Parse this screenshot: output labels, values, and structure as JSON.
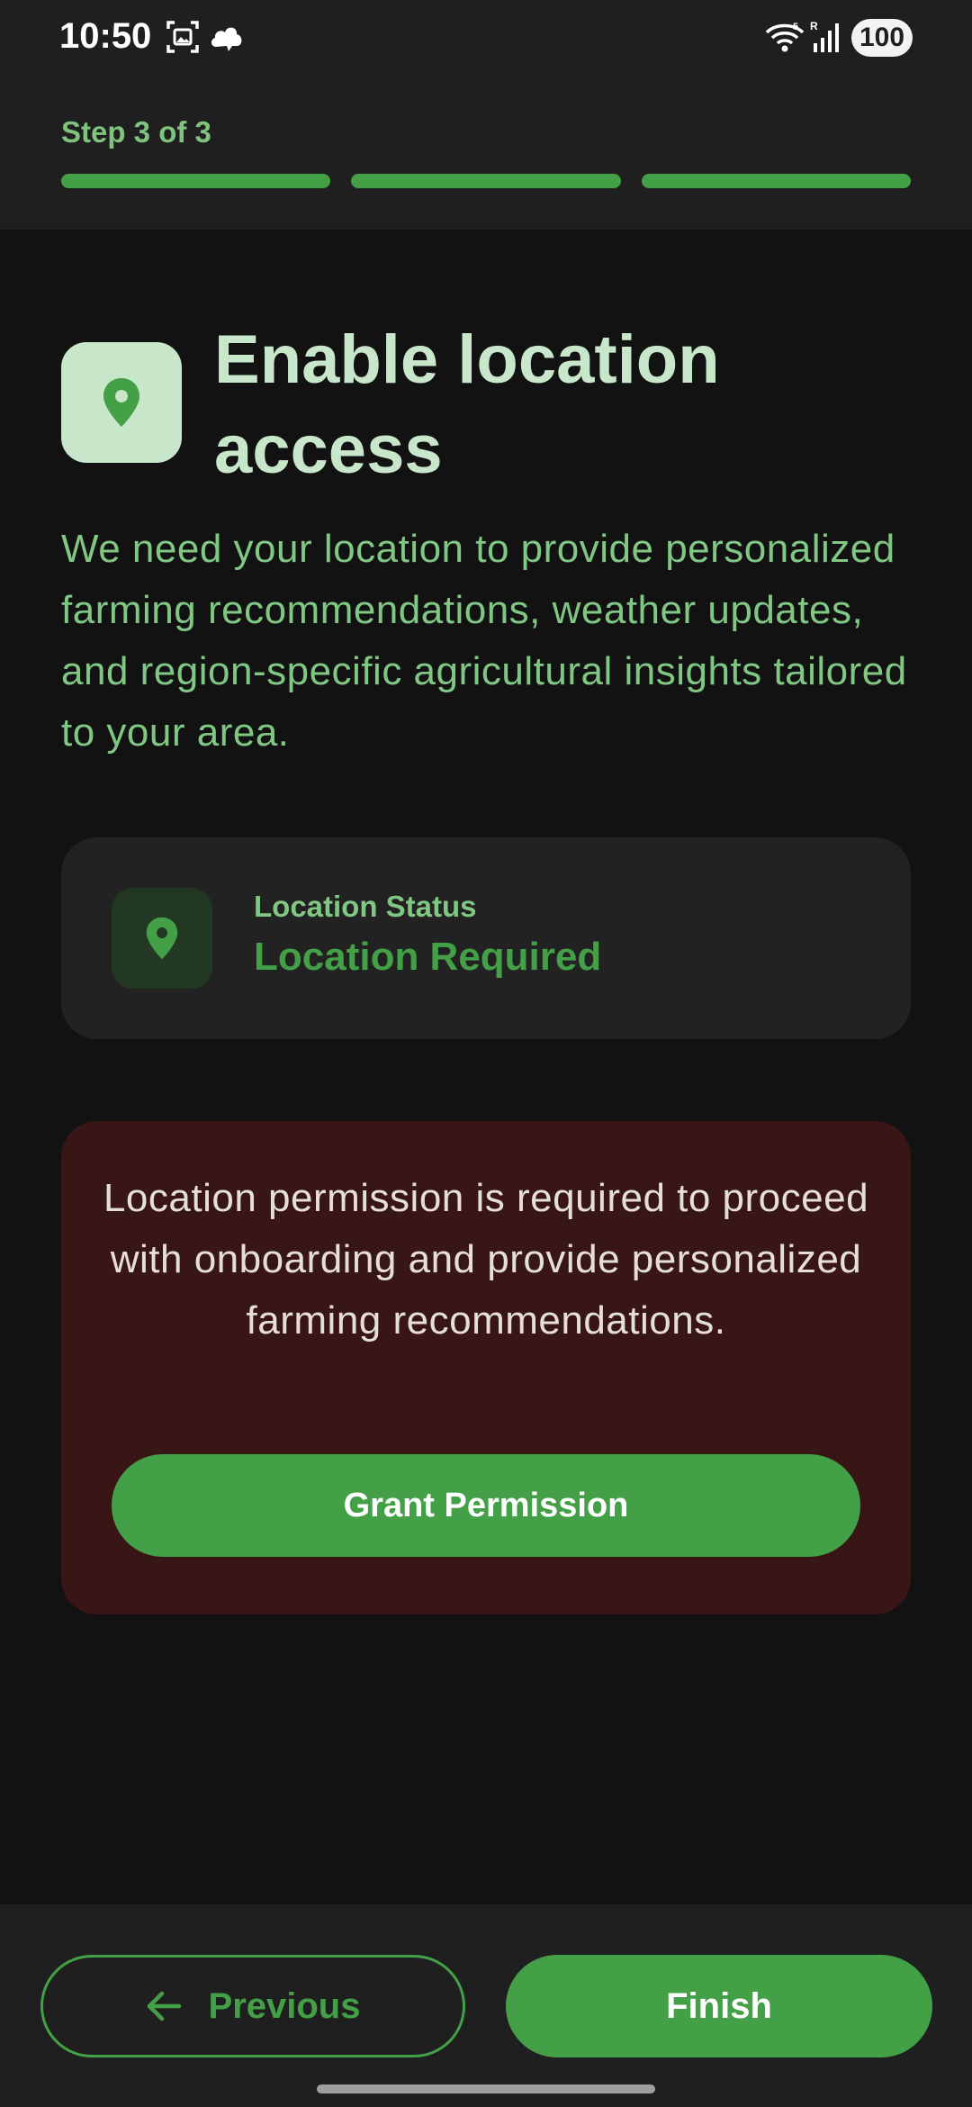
{
  "status_bar": {
    "time": "10:50",
    "battery": "100",
    "icons": [
      "screenshot-icon",
      "cloud-app-icon",
      "wifi-icon",
      "cell-signal-icon",
      "battery-icon"
    ]
  },
  "header": {
    "step_label": "Step 3 of 3",
    "progress": {
      "total_steps": 3,
      "completed_steps": 3
    }
  },
  "main": {
    "title": "Enable location access",
    "title_icon": "location-pin-icon",
    "description": "We need your location to provide personalized farming recommendations, weather updates, and region-specific agricultural insights tailored to your area."
  },
  "status_card": {
    "icon": "location-pin-icon",
    "label": "Location Status",
    "value": "Location Required"
  },
  "warning_card": {
    "message": "Location permission is required to proceed with onboarding and provide personalized farming recommendations.",
    "button_label": "Grant Permission"
  },
  "footer": {
    "previous_label": "Previous",
    "previous_icon": "arrow-left-icon",
    "finish_label": "Finish"
  },
  "colors": {
    "accent": "#43a047",
    "accent_light": "#81c784",
    "title": "#c8e6c9",
    "background": "#121212",
    "surface": "#1f1f1f",
    "warning_bg": "#391616"
  }
}
